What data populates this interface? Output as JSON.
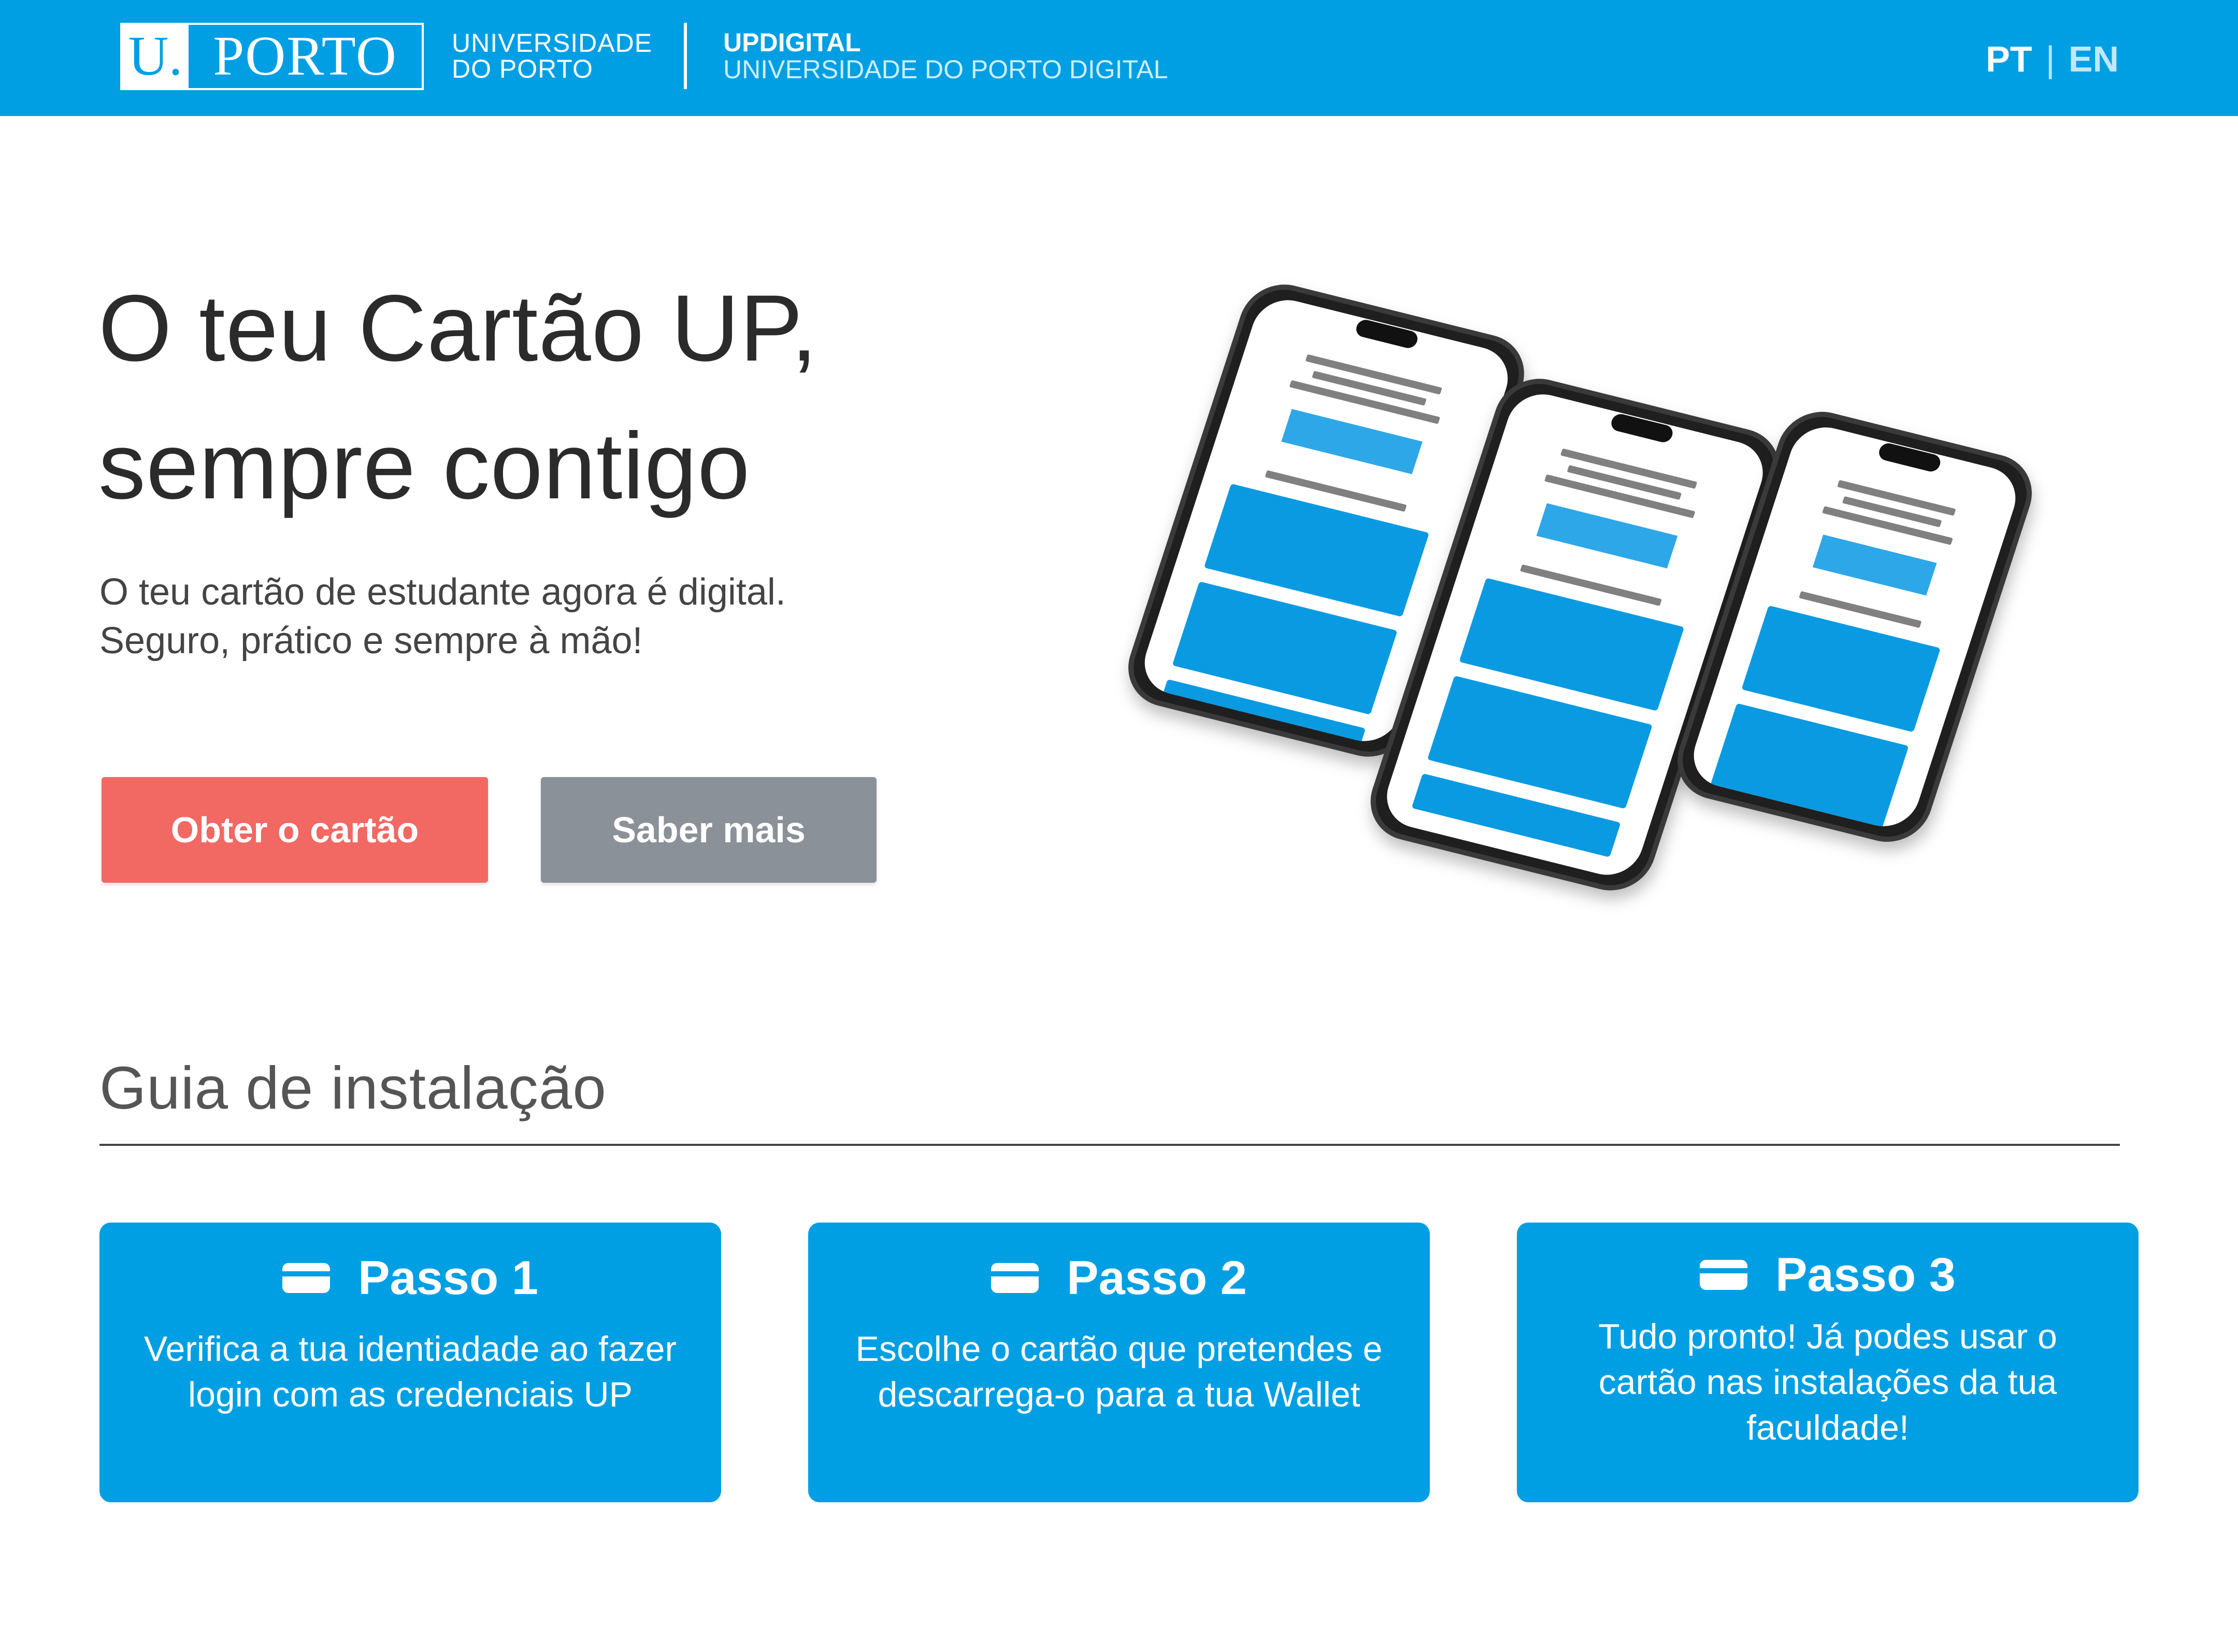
{
  "header": {
    "logo_u": "U.",
    "logo_porto": "PORTO",
    "uni_line1": "UNIVERSIDADE",
    "uni_line2": "DO PORTO",
    "updigital": "UPDIGITAL",
    "updigital_sub": "UNIVERSIDADE DO PORTO DIGITAL",
    "lang_pt": "PT",
    "lang_sep": "|",
    "lang_en": "EN"
  },
  "hero": {
    "title_line1": "O teu Cartão UP,",
    "title_line2": "sempre contigo",
    "sub_line1": "O teu cartão de estudante agora é digital.",
    "sub_line2": "Seguro, prático e sempre à mão!",
    "primary_button": "Obter o cartão",
    "secondary_button": "Saber mais"
  },
  "guide": {
    "title": "Guia  de instalação",
    "steps": [
      {
        "label": "Passo 1",
        "text": "Verifica a tua identiadade ao fazer login com as credenciais UP",
        "icon": "card-icon"
      },
      {
        "label": "Passo 2",
        "text": "Escolhe o cartão que pretendes e descarrega-o para a tua Wallet",
        "icon": "card-icon"
      },
      {
        "label": "Passo 3",
        "text": "Tudo pronto! Já podes usar o cartão nas instalações da tua faculdade!",
        "icon": "card-icon"
      }
    ]
  },
  "colors": {
    "brand_blue": "#009fe3",
    "primary_button": "#f26862",
    "secondary_button": "#8b9198"
  }
}
